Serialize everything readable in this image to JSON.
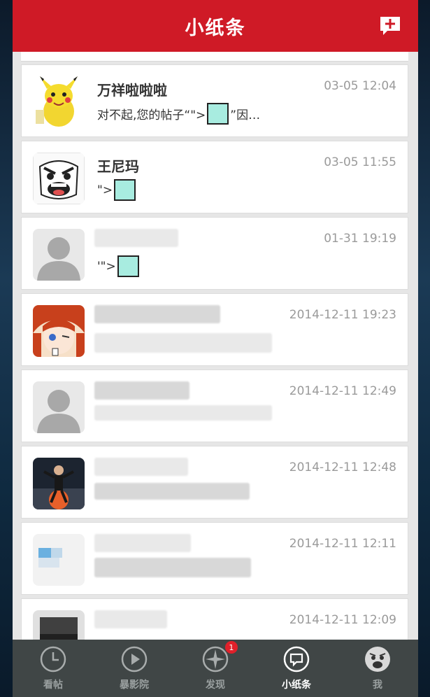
{
  "header": {
    "title": "小纸条",
    "compose_icon": "compose-message-icon"
  },
  "messages": [
    {
      "name": "万祥啦啦啦",
      "time": "03-05 12:04",
      "text_before": "对不起,您的帖子“\">",
      "text_after": "”因…",
      "avatar_icon": "pikachu-avatar"
    },
    {
      "name": "王尼玛",
      "time": "03-05 11:55",
      "text_before": "\">",
      "avatar_icon": "rage-face-avatar"
    },
    {
      "name": "",
      "time": "01-31 19:19",
      "text_before": "'\">",
      "avatar_icon": "default-user-avatar"
    },
    {
      "name": "",
      "time": "2014-12-11 19:23",
      "avatar_icon": "anime-girl-avatar"
    },
    {
      "name": "",
      "time": "2014-12-11 12:49",
      "avatar_icon": "default-user-avatar"
    },
    {
      "name": "",
      "time": "2014-12-11 12:48",
      "avatar_icon": "dancer-avatar"
    },
    {
      "name": "",
      "time": "2014-12-11 12:11",
      "avatar_icon": "blurred-avatar"
    },
    {
      "name": "",
      "time": "2014-12-11 12:09",
      "avatar_icon": "blurred-avatar"
    }
  ],
  "tabbar": {
    "tabs": [
      {
        "label": "看帖",
        "icon": "clock-icon"
      },
      {
        "label": "暴影院",
        "icon": "play-icon"
      },
      {
        "label": "发现",
        "icon": "compass-icon",
        "badge": "1"
      },
      {
        "label": "小纸条",
        "icon": "chat-bubble-icon",
        "active": true
      },
      {
        "label": "我",
        "icon": "profile-avatar-icon"
      }
    ]
  },
  "colors": {
    "header_bg": "#cf1a26",
    "tabbar_bg": "#404646",
    "badge": "#e0202a",
    "placeholder_box": "#a8ece0"
  }
}
